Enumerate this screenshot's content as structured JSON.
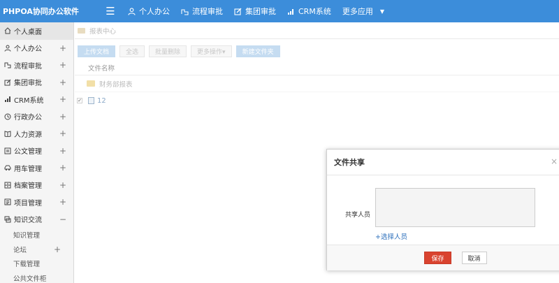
{
  "header": {
    "brand": "PHPOA协同办公软件",
    "nav": [
      {
        "label": "个人办公",
        "icon": "user-icon"
      },
      {
        "label": "流程审批",
        "icon": "workflow-icon"
      },
      {
        "label": "集团审批",
        "icon": "edit-icon"
      },
      {
        "label": "CRM系统",
        "icon": "bar-chart-icon"
      },
      {
        "label": "更多应用",
        "icon": "caret-down-icon"
      }
    ]
  },
  "sidebar": {
    "items": [
      {
        "label": "个人桌面",
        "icon": "home-icon",
        "expand": ""
      },
      {
        "label": "个人办公",
        "icon": "user-icon",
        "expand": "+"
      },
      {
        "label": "流程审批",
        "icon": "workflow-icon",
        "expand": "+"
      },
      {
        "label": "集团审批",
        "icon": "edit-icon",
        "expand": "+"
      },
      {
        "label": "CRM系统",
        "icon": "bar-chart-icon",
        "expand": "+"
      },
      {
        "label": "行政办公",
        "icon": "clock-icon",
        "expand": "+"
      },
      {
        "label": "人力资源",
        "icon": "book-icon",
        "expand": "+"
      },
      {
        "label": "公文管理",
        "icon": "document-icon",
        "expand": "+"
      },
      {
        "label": "用车管理",
        "icon": "car-icon",
        "expand": "+"
      },
      {
        "label": "档案管理",
        "icon": "archive-icon",
        "expand": "+"
      },
      {
        "label": "项目管理",
        "icon": "list-icon",
        "expand": "+"
      },
      {
        "label": "知识交流",
        "icon": "chat-icon",
        "expand": "−"
      }
    ],
    "sub_items": [
      {
        "label": "知识管理",
        "expand": ""
      },
      {
        "label": "论坛",
        "expand": "+"
      },
      {
        "label": "下载管理",
        "expand": ""
      },
      {
        "label": "公共文件柜",
        "expand": ""
      }
    ]
  },
  "main": {
    "breadcrumb": "报表中心",
    "toolbar": {
      "upload": "上传文档",
      "select_all": "全选",
      "batch_delete": "批量删除",
      "more_ops": "更多操作▾",
      "new_folder": "新建文件夹"
    },
    "column_header": "文件名称",
    "folder_row": "财务部报表",
    "file_row": "12"
  },
  "dialog": {
    "title": "文件共享",
    "close": "×",
    "label": "共享人员",
    "textarea_value": "",
    "select_link": "+选择人员",
    "save": "保存",
    "cancel": "取消"
  },
  "colors": {
    "header_bg": "#3c8dda",
    "save_button": "#d9432f",
    "link": "#2a6ebb"
  }
}
